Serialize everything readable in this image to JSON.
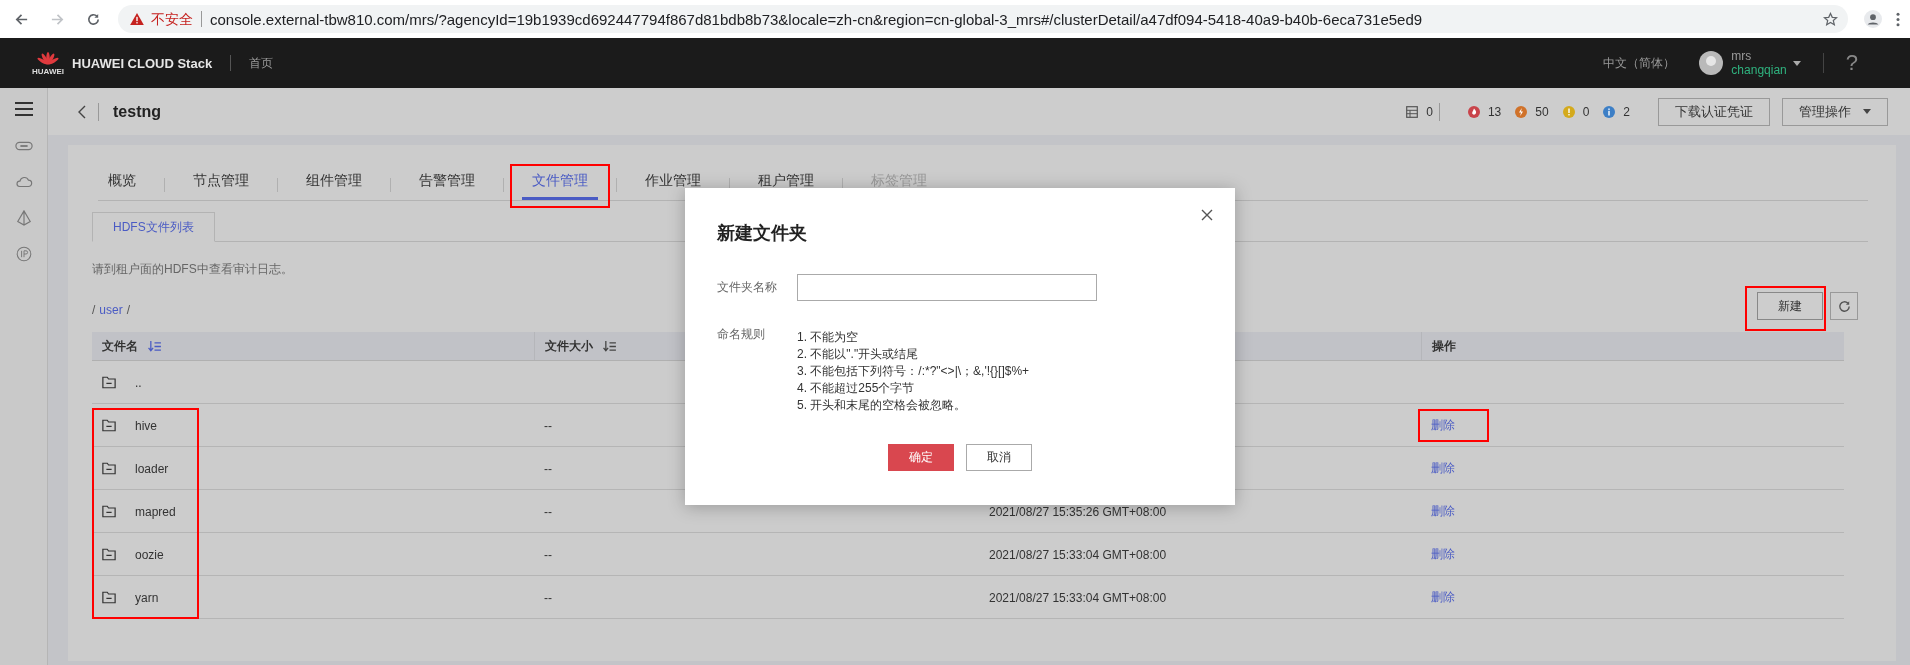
{
  "browser": {
    "forward_enabled": false,
    "security_label": "不安全",
    "url": "console.external-tbw810.com/mrs/?agencyId=19b1939cd692447794f867d81bdb8b73&locale=zh-cn&region=cn-global-3_mrs#/clusterDetail/a47df094-5418-40a9-b40b-6eca731e5ed9"
  },
  "top_nav": {
    "logo_caption": "HUAWEI",
    "brand": "HUAWEI CLOUD Stack",
    "home": "首页",
    "language": "中文（简体）",
    "user_name": "mrs",
    "account": "changqian",
    "help": "?"
  },
  "cluster_header": {
    "title": "testng",
    "status_counts": [
      {
        "kind": "host",
        "count": "0"
      },
      {
        "kind": "critical",
        "count": "13",
        "color": "#c9444b"
      },
      {
        "kind": "major",
        "count": "50",
        "color": "#d0722a"
      },
      {
        "kind": "minor",
        "count": "0",
        "color": "#d4aa1c"
      },
      {
        "kind": "info",
        "count": "2",
        "color": "#3d7fc6"
      }
    ],
    "buttons": [
      {
        "label": "下载认证凭证",
        "dropdown": false
      },
      {
        "label": "管理操作",
        "dropdown": true
      }
    ]
  },
  "tabs": [
    {
      "label": "概览",
      "selected": false,
      "disabled": false,
      "highlighted": false
    },
    {
      "label": "节点管理",
      "selected": false,
      "disabled": false,
      "highlighted": false
    },
    {
      "label": "组件管理",
      "selected": false,
      "disabled": false,
      "highlighted": false
    },
    {
      "label": "告警管理",
      "selected": false,
      "disabled": false,
      "highlighted": false
    },
    {
      "label": "文件管理",
      "selected": true,
      "disabled": false,
      "highlighted": true
    },
    {
      "label": "作业管理",
      "selected": false,
      "disabled": false,
      "highlighted": false
    },
    {
      "label": "租户管理",
      "selected": false,
      "disabled": false,
      "highlighted": false
    },
    {
      "label": "标签管理",
      "selected": false,
      "disabled": true,
      "highlighted": false
    }
  ],
  "subtabs": [
    {
      "label": "HDFS文件列表",
      "selected": true
    }
  ],
  "notice": "请到租户面的HDFS中查看审计日志。",
  "breadcrumb": [
    {
      "label": "/",
      "link": false
    },
    {
      "label": "user",
      "link": true
    },
    {
      "label": "/",
      "link": false
    }
  ],
  "new_button": {
    "label": "新建",
    "highlighted": true
  },
  "table": {
    "columns": [
      {
        "label": "文件名",
        "sortable": true,
        "sort_active": true
      },
      {
        "label": "文件大小",
        "sortable": true,
        "sort_active": false
      },
      {},
      {
        "label": "操作",
        "sortable": false
      }
    ],
    "rows": [
      {
        "name": "..",
        "name_highlighted": false
      },
      {
        "name": "hive",
        "size": "--",
        "action": "删除",
        "name_highlighted": true,
        "action_highlighted": true
      },
      {
        "name": "loader",
        "size": "--",
        "action": "删除",
        "name_highlighted": true,
        "action_highlighted": false
      },
      {
        "name": "mapred",
        "size": "--",
        "modified": "2021/08/27 15:35:26 GMT+08:00",
        "action": "删除",
        "name_highlighted": true,
        "action_highlighted": false
      },
      {
        "name": "oozie",
        "size": "--",
        "modified": "2021/08/27 15:33:04 GMT+08:00",
        "action": "删除",
        "name_highlighted": true,
        "action_highlighted": false
      },
      {
        "name": "yarn",
        "size": "--",
        "modified": "2021/08/27 15:33:04 GMT+08:00",
        "action": "删除",
        "name_highlighted": true,
        "action_highlighted": false
      }
    ]
  },
  "dialog": {
    "title": "新建文件夹",
    "field_label": "文件夹名称",
    "rules_label": "命名规则",
    "rules": [
      "1. 不能为空",
      "2. 不能以\".\"开头或结尾",
      "3. 不能包括下列符号：/:*?\"<>|\\；&,'!{}[]$%+",
      "4. 不能超过255个字节",
      "5. 开头和末尾的空格会被忽略。"
    ],
    "buttons": [
      {
        "label": "确定",
        "kind": "primary"
      },
      {
        "label": "取消",
        "kind": "secondary"
      }
    ]
  }
}
